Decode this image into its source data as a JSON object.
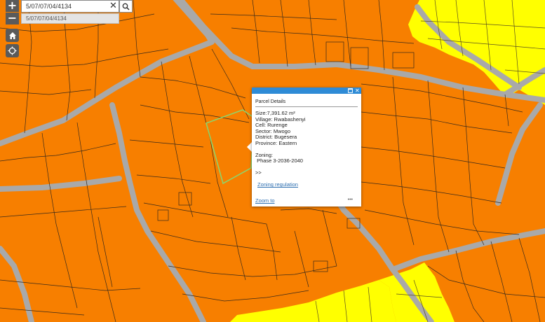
{
  "search": {
    "value": "5/07/07/04/4134",
    "suggestion": "5/07/07/04/4134"
  },
  "controls": {
    "zoom_in": "+",
    "zoom_out": "−"
  },
  "icons": {
    "zoom_in": "plus-icon",
    "zoom_out": "minus-icon",
    "home": "home-icon",
    "locate": "locate-icon",
    "search": "search-icon",
    "clear": "close-icon",
    "maximize": "maximize-icon",
    "close": "close-icon",
    "more": "ellipsis-icon"
  },
  "popup": {
    "title": "Parcel Details",
    "size": "Size:7,391.62 m²",
    "village": "Village: Rwabashenyi",
    "cell": "Cell: Rurenge",
    "sector": "Sector: Mwogo",
    "district": "District: Bugesera",
    "province": "Province: Eastern",
    "zoning_label": "Zoning:",
    "zoning_value": " Phase 3-2036-2040",
    "more": ">>",
    "zoning_link": "Zoning regulation",
    "zoom_to": "Zoom to",
    "ellipsis": "•••",
    "close_glyph": "✕"
  },
  "colors": {
    "parcel_orange": "#f77f00",
    "parcel_yellow": "#ffff00",
    "road_gray": "#a9a9a9",
    "boundary": "#3a2a1a",
    "highlight": "#8fd36a",
    "header_blue": "#2e8bd6"
  }
}
